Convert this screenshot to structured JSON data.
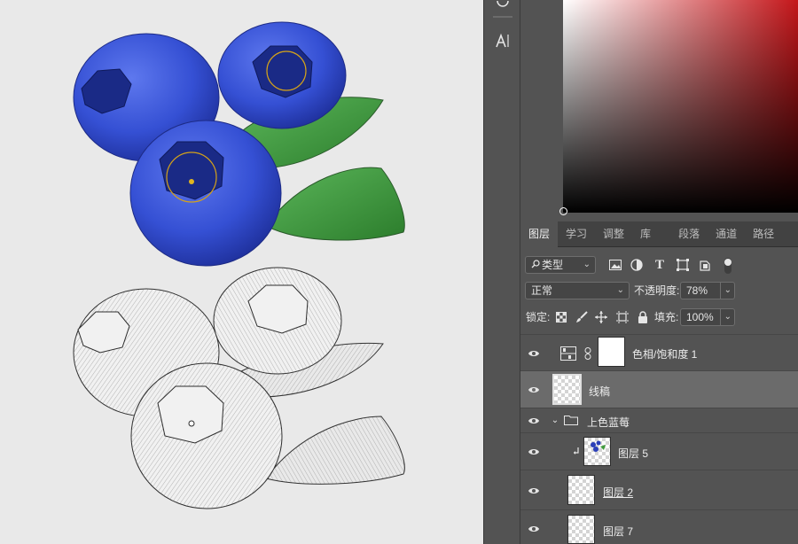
{
  "panel_tabs": [
    "图层",
    "学习",
    "调整",
    "库",
    "段落",
    "通道",
    "路径"
  ],
  "filter": {
    "kind_label": "类型"
  },
  "blend": {
    "mode": "正常",
    "opacity_label": "不透明度:",
    "opacity_value": "78%"
  },
  "lock": {
    "label": "锁定:",
    "fill_label": "填充:",
    "fill_value": "100%"
  },
  "layers": [
    {
      "name": "色相/饱和度 1",
      "type": "adjustment"
    },
    {
      "name": "线稿",
      "type": "pixel",
      "selected": true
    },
    {
      "name": "上色蓝莓",
      "type": "group",
      "expanded": true
    },
    {
      "name": "图层 5",
      "type": "pixel",
      "clipped": true
    },
    {
      "name": "图层 2",
      "type": "pixel",
      "underlined": true
    },
    {
      "name": "图层 7",
      "type": "pixel"
    }
  ],
  "colors": {
    "accent_red": "#c4161a",
    "panel_bg": "#535353",
    "canvas_bg": "#e9e9e9",
    "berry_blue": "#3a55d6",
    "leaf_green": "#3f9a3c"
  }
}
